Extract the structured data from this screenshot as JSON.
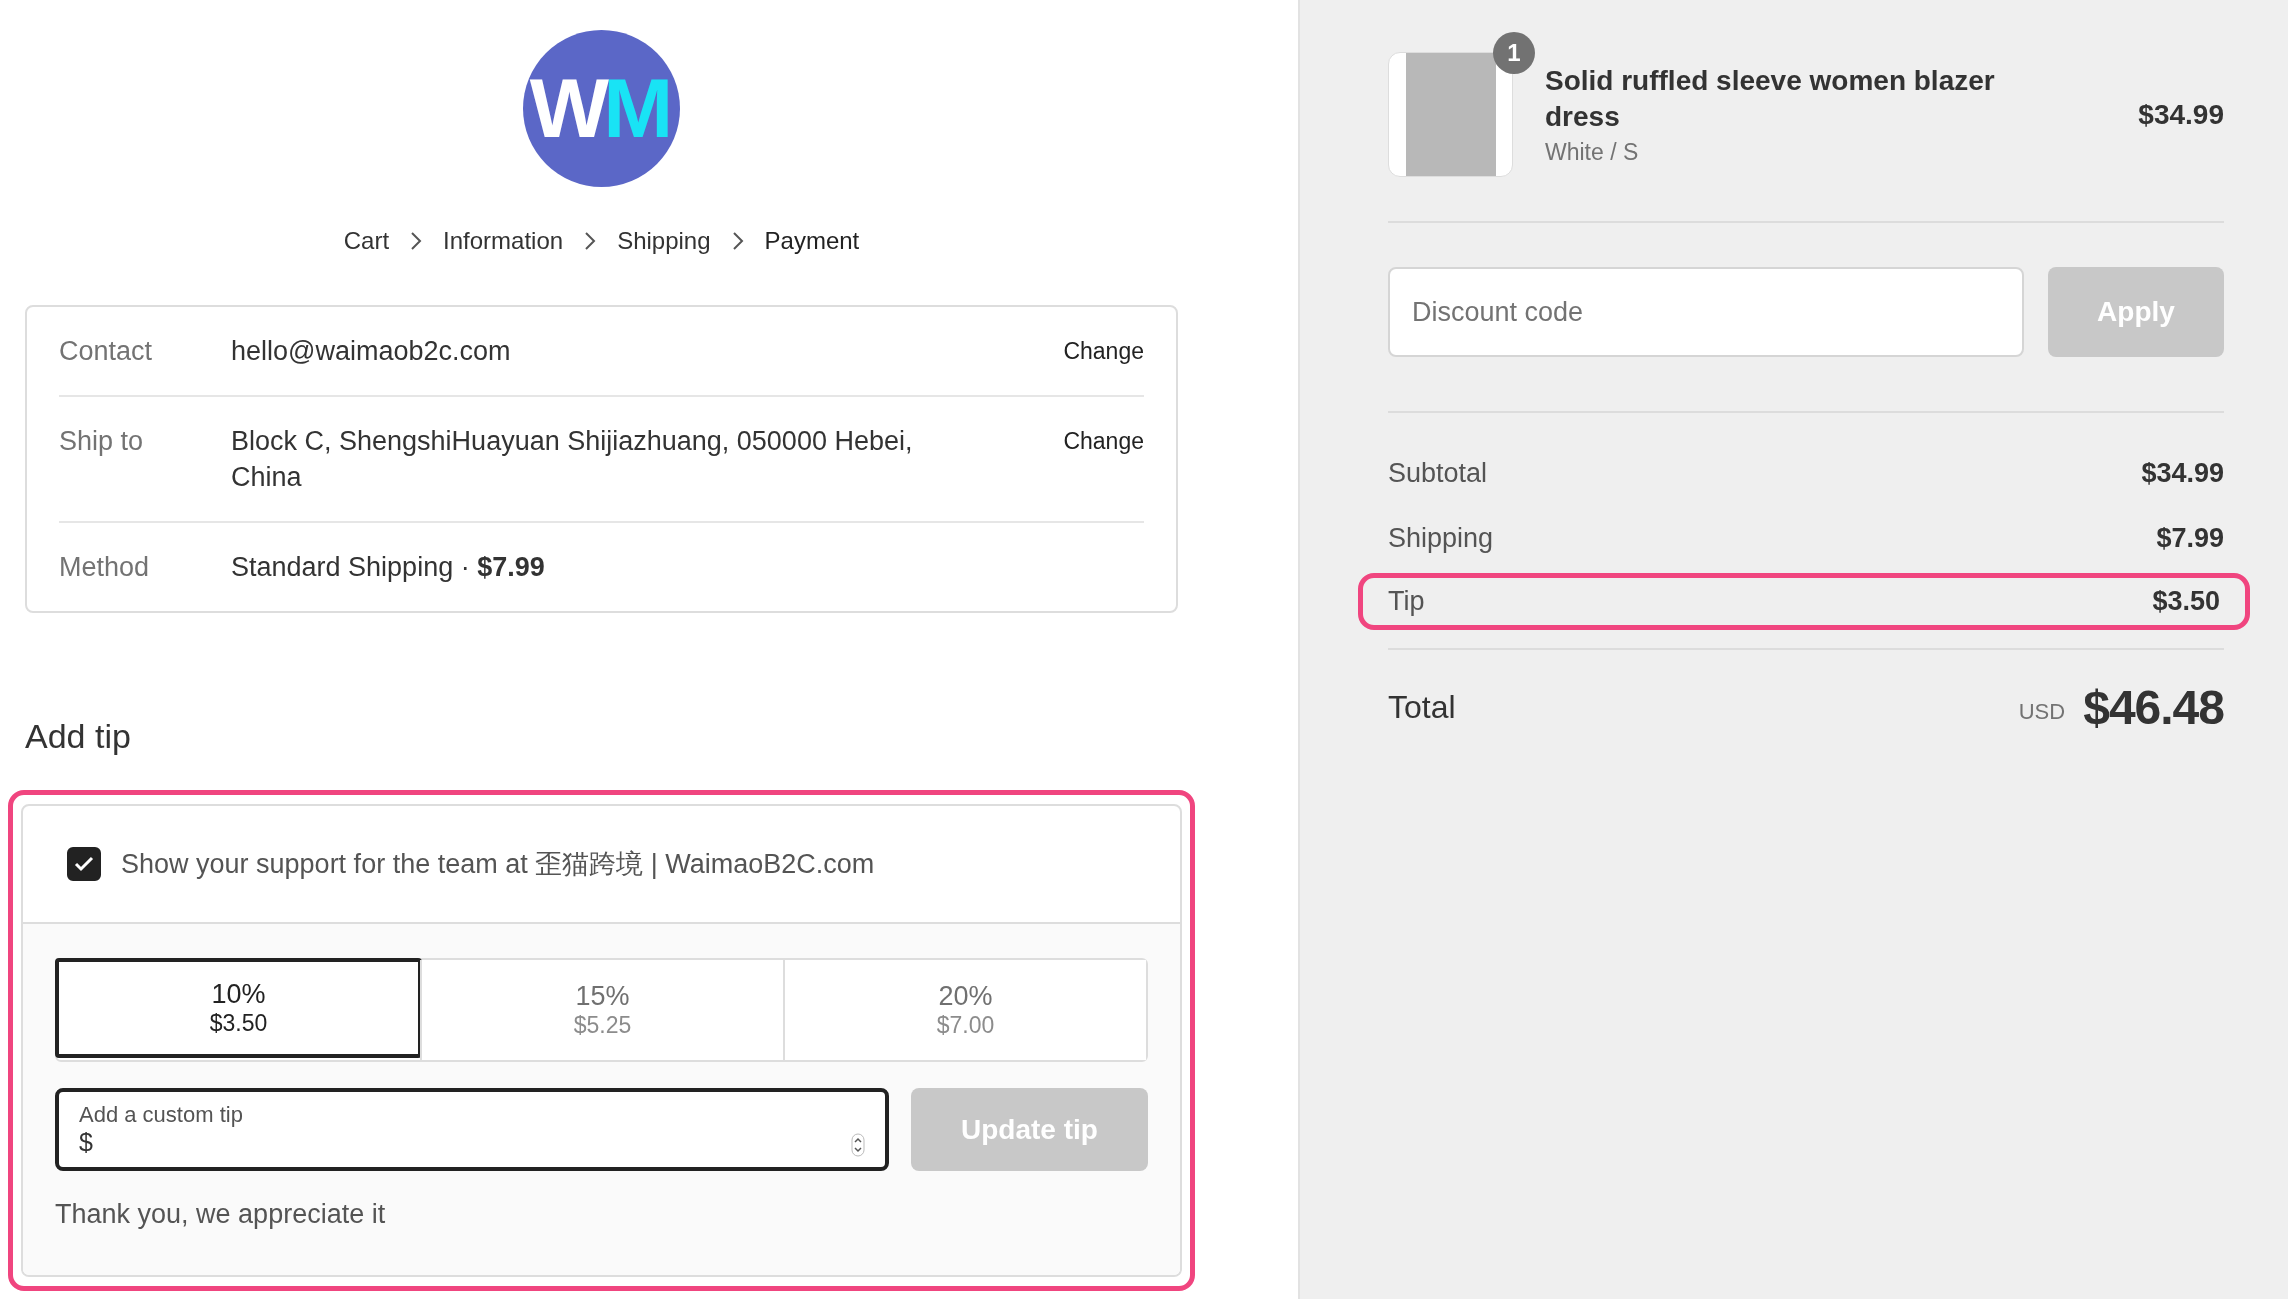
{
  "logo": {
    "parts": [
      {
        "text": "W",
        "color": "#ffffff"
      },
      {
        "text": "M",
        "color": "#19e3f5"
      }
    ]
  },
  "breadcrumb": [
    {
      "label": "Cart",
      "selected": false
    },
    {
      "label": "Information",
      "selected": false
    },
    {
      "label": "Shipping",
      "selected": false
    },
    {
      "label": "Payment",
      "selected": true
    }
  ],
  "review": [
    {
      "label": "Contact",
      "value": "hello@waimaob2c.com",
      "action": "Change"
    },
    {
      "label": "Ship to",
      "value": "Block C, ShengshiHuayuan Shijiazhuang, 050000 Hebei, China",
      "action": "Change"
    },
    {
      "label": "Method",
      "value": "Standard Shipping · **$7.99**"
    }
  ],
  "tip": {
    "title": "Add tip",
    "highlighted": true,
    "checkbox": {
      "label": "Show your support for the team at 歪猫跨境 | WaimaoB2C.com",
      "checked": true
    },
    "options": [
      {
        "percent": "10%",
        "amount": "$3.50",
        "selected": true
      },
      {
        "percent": "15%",
        "amount": "$5.25",
        "selected": false
      },
      {
        "percent": "20%",
        "amount": "$7.00",
        "selected": false
      }
    ],
    "custom": {
      "label": "Add a custom tip",
      "prefix": "$"
    },
    "update_button": {
      "label": "Update tip",
      "disabled": true
    },
    "thanks": "Thank you, we appreciate it"
  },
  "summary": {
    "item": {
      "name": "Solid ruffled sleeve women blazer dress",
      "variant": "White / S",
      "price": "$34.99",
      "quantity": "1"
    },
    "discount": {
      "placeholder": "Discount code",
      "button": "Apply",
      "disabled": true
    },
    "lines": [
      {
        "label": "Subtotal",
        "value": "$34.99",
        "highlighted": false
      },
      {
        "label": "Shipping",
        "value": "$7.99",
        "highlighted": false
      },
      {
        "label": "Tip",
        "value": "$3.50",
        "highlighted": true
      }
    ],
    "total": {
      "label": "Total",
      "currency": "USD",
      "value": "$46.48"
    }
  }
}
